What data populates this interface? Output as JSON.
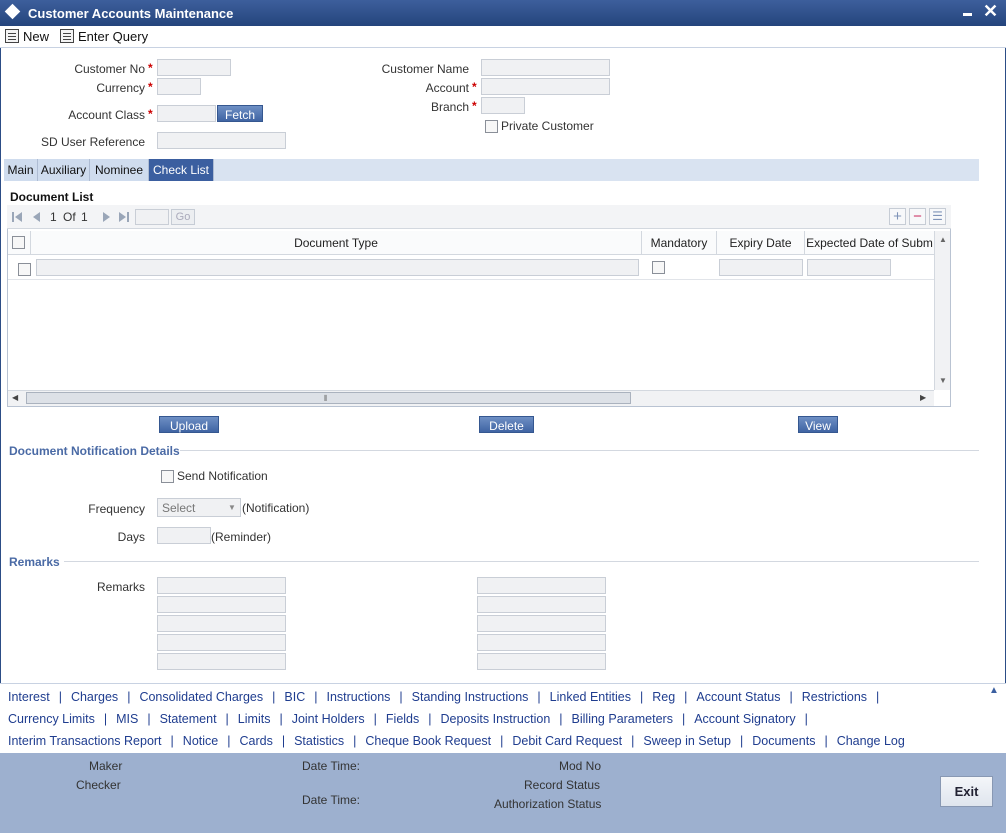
{
  "window": {
    "title": "Customer Accounts Maintenance"
  },
  "toolbar": {
    "new_label": "New",
    "enter_query_label": "Enter Query"
  },
  "form": {
    "customer_no_label": "Customer No",
    "currency_label": "Currency",
    "account_class_label": "Account Class",
    "sd_user_reference_label": "SD User Reference",
    "customer_name_label": "Customer Name",
    "account_label": "Account",
    "branch_label": "Branch",
    "private_customer_label": "Private Customer",
    "fetch_label": "Fetch",
    "required_mark": "*"
  },
  "tabs": [
    {
      "label": "Main"
    },
    {
      "label": "Auxiliary"
    },
    {
      "label": "Nominee"
    },
    {
      "label": "Check List"
    }
  ],
  "document_list": {
    "title": "Document List",
    "page_current": "1",
    "page_of": "Of",
    "page_total": "1",
    "go_label": "Go",
    "columns": [
      "Document Type",
      "Mandatory",
      "Expiry Date",
      "Expected Date of Subm"
    ]
  },
  "actions": {
    "upload_label": "Upload",
    "delete_label": "Delete",
    "view_label": "View"
  },
  "notification": {
    "title": "Document Notification Details",
    "send_label": "Send Notification",
    "frequency_label": "Frequency",
    "frequency_value": "Select",
    "frequency_suffix": "(Notification)",
    "days_label": "Days",
    "days_suffix": "(Reminder)"
  },
  "remarks": {
    "title": "Remarks",
    "label": "Remarks"
  },
  "links": {
    "row1": [
      "Interest",
      "Charges",
      "Consolidated Charges",
      "BIC",
      "Instructions",
      "Standing Instructions",
      "Linked Entities",
      "Reg",
      "Account Status",
      "Restrictions"
    ],
    "row2": [
      "Currency Limits",
      "MIS",
      "Statement",
      "Limits",
      "Joint Holders",
      "Fields",
      "Deposits Instruction",
      "Billing Parameters",
      "Account Signatory"
    ],
    "row3": [
      "Interim Transactions Report",
      "Notice",
      "Cards",
      "Statistics",
      "Cheque Book Request",
      "Debit Card Request",
      "Sweep in Setup",
      "Documents",
      "Change Log"
    ],
    "separator": "|"
  },
  "audit": {
    "maker_label": "Maker",
    "checker_label": "Checker",
    "date_time_label": "Date Time:",
    "mod_no_label": "Mod No",
    "record_status_label": "Record Status",
    "authorization_status_label": "Authorization Status",
    "exit_label": "Exit"
  }
}
